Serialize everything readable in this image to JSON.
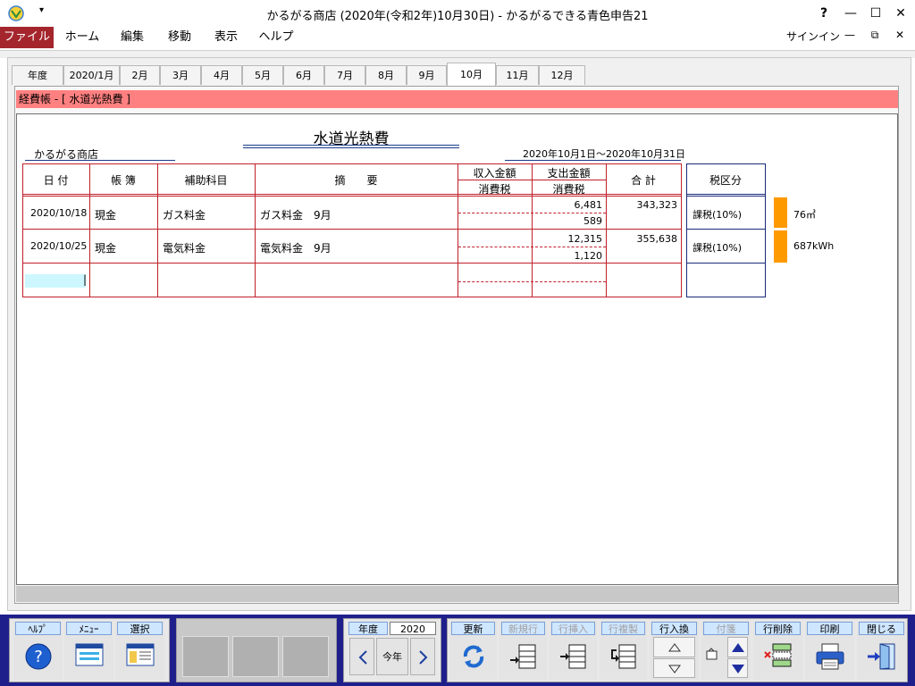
{
  "window": {
    "title": "かるがる商店 (2020年(令和2年)10月30日) - かるがるできる青色申告21",
    "help_btn": "?",
    "min_btn": "—",
    "max_btn": "☐",
    "close_btn": "✕"
  },
  "menu": {
    "items": [
      "ファイル",
      "ホーム",
      "編集",
      "移動",
      "表示",
      "ヘルプ"
    ],
    "signin": "サインイン",
    "sub_min": "—",
    "sub_restore": "⧉",
    "sub_close": "✕"
  },
  "tabs": [
    "年度",
    "2020/1月",
    "2月",
    "3月",
    "4月",
    "5月",
    "6月",
    "7月",
    "8月",
    "9月",
    "10月",
    "11月",
    "12月"
  ],
  "active_tab": "10月",
  "section": {
    "label": "経費帳 - [ 水道光熱費 ]"
  },
  "sheet": {
    "title": "水道光熱費",
    "store": "かるがる商店",
    "period": "2020年10月1日～2020年10月31日",
    "headers": {
      "date": "日 付",
      "book": "帳 簿",
      "sub_account": "補助科目",
      "description": "摘　　要",
      "income": "収入金額",
      "income_tax": "消費税",
      "expense": "支出金額",
      "expense_tax": "消費税",
      "total": "合 計",
      "tax_class": "税区分"
    },
    "rows": [
      {
        "date": "2020/10/18",
        "book": "現金",
        "sub_account": "ガス料金",
        "description": "ガス料金　9月",
        "expense": "6,481",
        "expense_tax": "589",
        "total": "343,323",
        "tax_class": "課税(10%)",
        "usage": "76㎥"
      },
      {
        "date": "2020/10/25",
        "book": "現金",
        "sub_account": "電気料金",
        "description": "電気料金　9月",
        "expense": "12,315",
        "expense_tax": "1,120",
        "total": "355,638",
        "tax_class": "課税(10%)",
        "usage": "687kWh"
      }
    ],
    "input_cursor": "|"
  },
  "toolbar": {
    "help": "ﾍﾙﾌﾟ",
    "menu": "ﾒﾆｭｰ",
    "select": "選択",
    "year_label": "年度",
    "year_value": "2020",
    "this_year": "今年",
    "update": "更新",
    "new_row": "新規行",
    "insert_row": "行挿入",
    "copy_row": "行複製",
    "swap_row": "行入換",
    "tag": "付箋",
    "delete_row": "行削除",
    "print": "印刷",
    "close": "閉じる"
  }
}
